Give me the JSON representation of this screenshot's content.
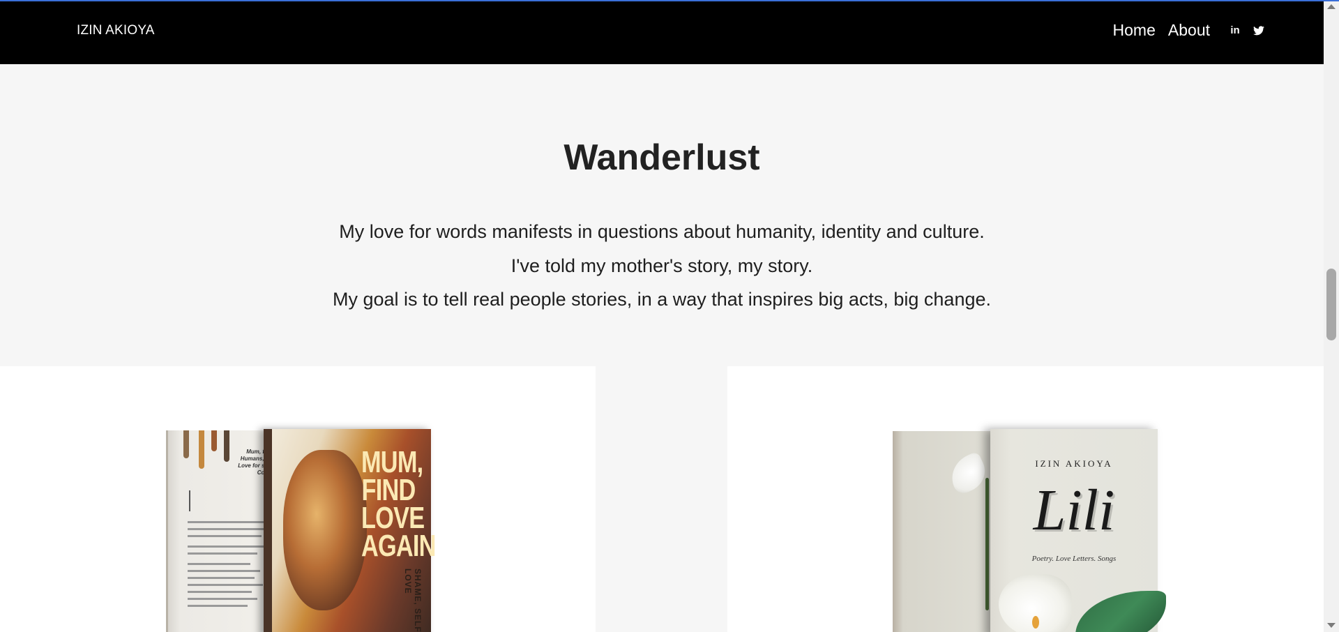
{
  "navbar": {
    "brand": "IZIN AKIOYA",
    "links": [
      {
        "label": "Home"
      },
      {
        "label": "About"
      }
    ],
    "social": [
      {
        "icon": "linkedin-icon",
        "glyph": "in"
      },
      {
        "icon": "twitter-icon"
      }
    ]
  },
  "hero": {
    "title": "Wanderlust",
    "lines": [
      "My love for words manifests in questions about humanity, identity and culture.",
      "I've told my mother's story, my story.",
      "My goal is to tell real people stories, in a way that inspires big acts, big change."
    ]
  },
  "books": [
    {
      "cover_title": "MUM, FIND LOVE AGAIN",
      "spine_text": "SHAME, SELF-LOVE",
      "back_quote": "Mum, find Humans, Re Love for self, Come"
    },
    {
      "author": "IZIN AKIOYA",
      "cover_title": "Lili",
      "subtitle": "Poetry. Love Letters. Songs"
    }
  ],
  "colors": {
    "navbar_bg": "#000000",
    "page_bg": "#f6f6f6",
    "card_bg": "#ffffff",
    "accent_line": "#3a6fd8"
  }
}
